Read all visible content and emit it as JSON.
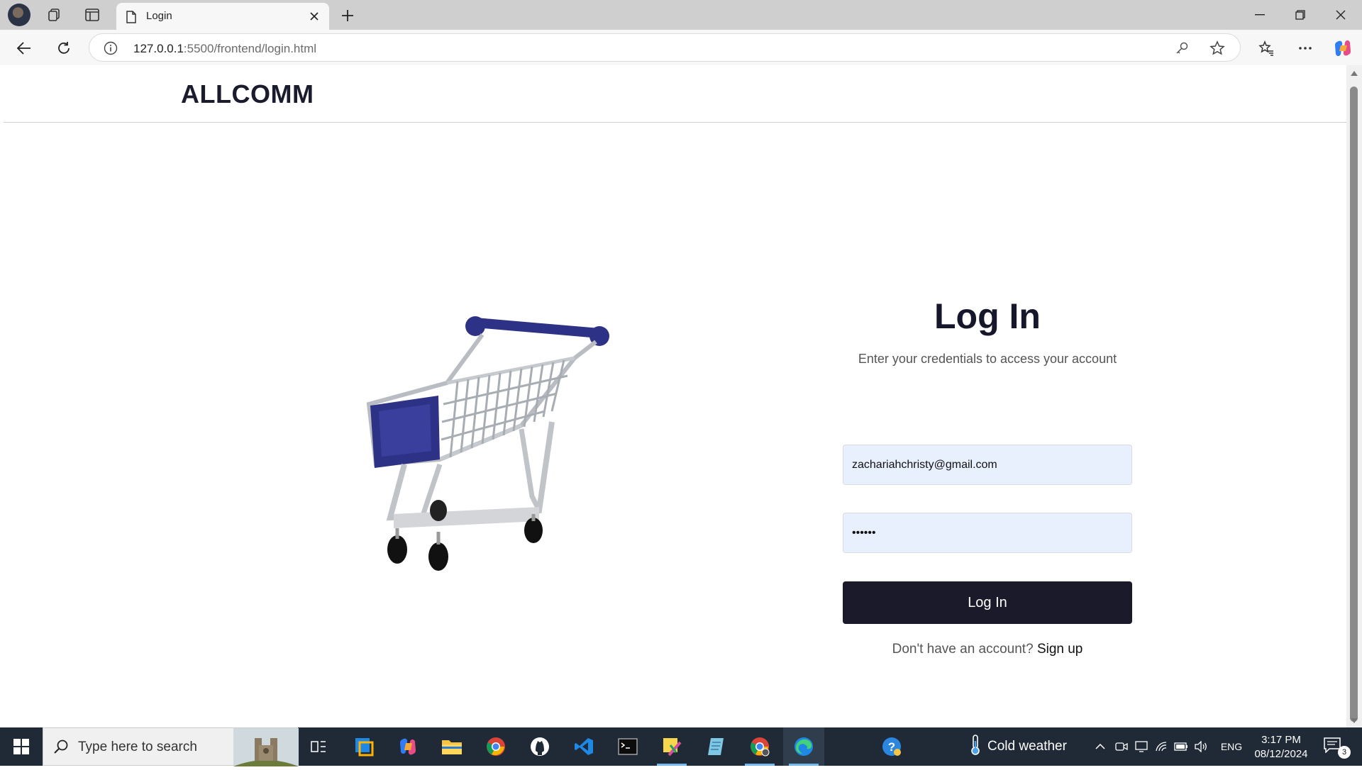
{
  "browser": {
    "tab_title": "Login",
    "url_host": "127.0.0.1",
    "url_path": ":5500/frontend/login.html"
  },
  "page": {
    "brand": "ALLCOMM",
    "login": {
      "title": "Log In",
      "subtitle": "Enter your credentials to access your account",
      "email_value": "zachariahchristy@gmail.com",
      "password_value": "••••••",
      "button_label": "Log In",
      "signup_prompt": "Don't have an account?",
      "signup_link": "Sign up"
    }
  },
  "taskbar": {
    "search_placeholder": "Type here to search",
    "weather": "Cold weather",
    "language": "ENG",
    "time": "3:17 PM",
    "date": "08/12/2024",
    "notification_count": "3",
    "apps": [
      "task-view",
      "remote-desktop",
      "copilot",
      "file-explorer",
      "chrome",
      "github-desktop",
      "vscode",
      "terminal",
      "sticky-notes",
      "notepad",
      "chrome-profile",
      "edge",
      "help"
    ]
  },
  "colors": {
    "brand": "#1b1b2e",
    "button_bg": "#1a1a2b",
    "input_bg": "#e8f0fe",
    "cart_accent": "#2e3287",
    "taskbar_bg": "#1f2a36"
  }
}
